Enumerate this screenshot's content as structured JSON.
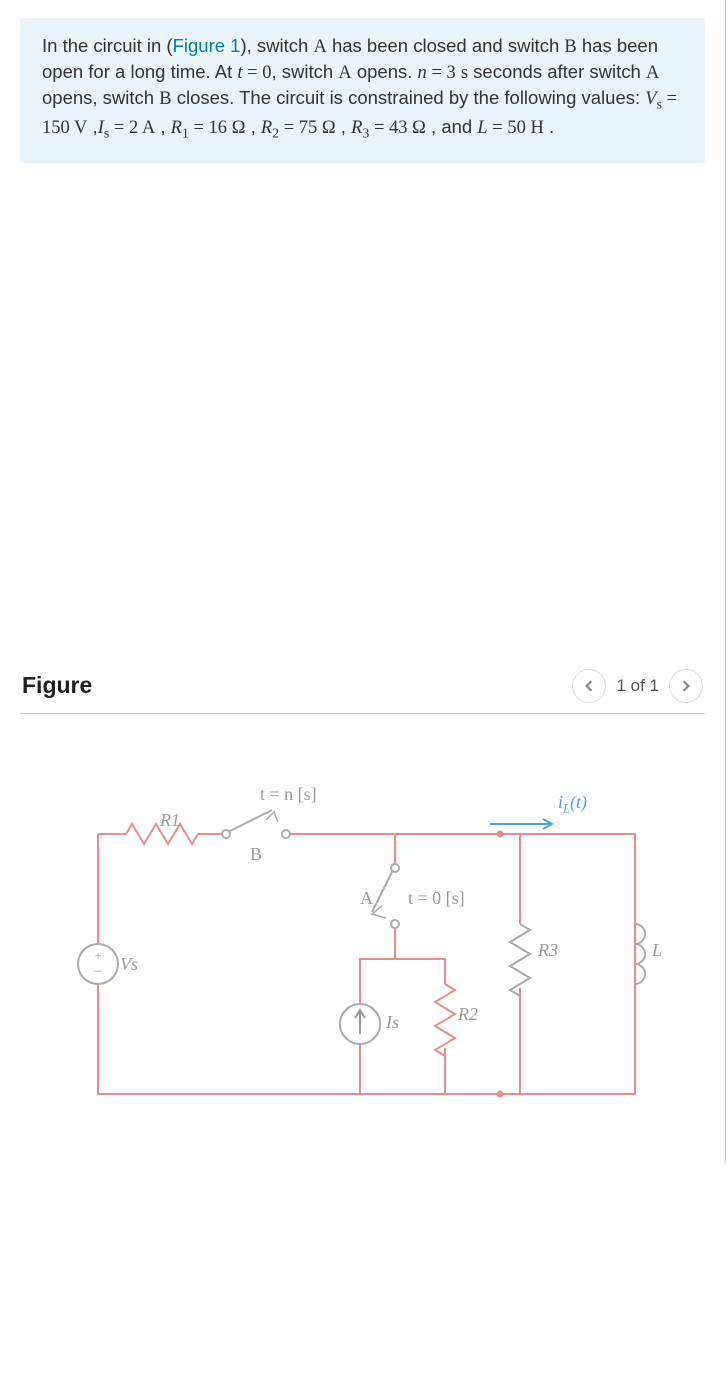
{
  "problem": {
    "prefix": "In the circuit in (",
    "figlink": "Figure 1",
    "after_fig": "), switch ",
    "A1": "A",
    "t2": " has been closed and switch ",
    "B1": "B",
    "t3": " has been open for a long time. At ",
    "eq_t0_lhs": "t",
    "eq_t0_mid": " = ",
    "eq_t0_rhs": "0",
    "t4": ", switch ",
    "A2": "A",
    "t5": " opens.  ",
    "n_lhs": "n",
    "n_mid": " = ",
    "n_rhs": "3",
    "t6": " ",
    "s_unit": "s",
    "t7": "  seconds after switch ",
    "A3": "A",
    "t8": " opens, switch ",
    "B2": "B",
    "t9": " closes. The circuit is constrained by the following values: ",
    "Vs_sym": "V",
    "Vs_sub": "s",
    "Vs_eq": " = 150 ",
    "Vs_unit": "V",
    "sep1": " ,",
    "Is_sym": "I",
    "Is_sub": "s",
    "Is_eq": " = 2 ",
    "Is_unit": "A",
    "sep2": " , ",
    "R1_sym": "R",
    "R1_sub": "1",
    "R1_eq": " = 16 ",
    "R1_unit": "Ω",
    "sep3": " , ",
    "R2_sym": "R",
    "R2_sub": "2",
    "R2_eq": " = 75 ",
    "R2_unit": "Ω",
    "sep4": " , ",
    "R3_sym": "R",
    "R3_sub": "3",
    "R3_eq": " = 43 ",
    "R3_unit": "Ω",
    "sep5": " , and ",
    "L_sym": "L",
    "L_eq": " = 50 ",
    "L_unit": "H",
    "end": " ."
  },
  "figure": {
    "title": "Figure",
    "page": "1 of 1"
  },
  "circuit": {
    "switchB_time": "t = n [s]",
    "switchA_time": "t = 0 [s]",
    "R1": "R1",
    "R2": "R2",
    "R3": "R3",
    "L": "L",
    "Vs": "Vs",
    "Is": "Is",
    "A": "A",
    "B": "B",
    "IL": "i",
    "IL_sub": "L",
    "IL_arg": "(t)"
  }
}
